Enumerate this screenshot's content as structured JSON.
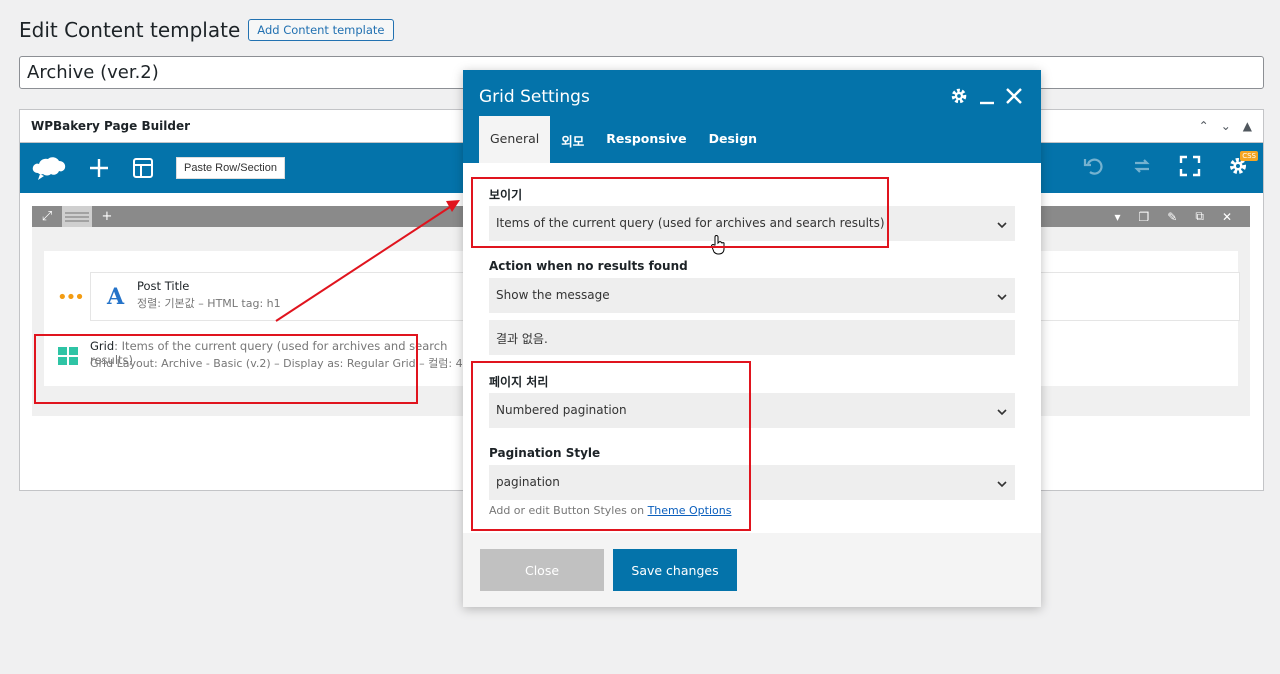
{
  "page": {
    "title": "Edit Content template",
    "add_button": "Add Content template",
    "title_value": "Archive (ver.2)"
  },
  "wpbakery": {
    "title": "WPBakery Page Builder",
    "paste_button": "Paste Row/Section",
    "css_badge": "CSS",
    "elements": [
      {
        "title": "Post Title",
        "subtitle": "정렬: 기본값  – HTML tag: h1"
      },
      {
        "title_strong": "Grid",
        "title_rest": ": Items of the current query (used for archives and search results)",
        "subtitle": "Grid Layout: Archive - Basic (v.2) – Display as: Regular Grid – 컬럼: 4"
      }
    ]
  },
  "modal": {
    "title": "Grid Settings",
    "tabs": [
      "General",
      "외모",
      "Responsive",
      "Design"
    ],
    "fields": {
      "visibility_label": "보이기",
      "visibility_value": "Items of the current query (used for archives and search results)",
      "no_results_label": "Action when no results found",
      "no_results_value": "Show the message",
      "message_value": "결과 없음.",
      "pagination_label": "페이지 처리",
      "pagination_value": "Numbered pagination",
      "pagination_style_label": "Pagination Style",
      "pagination_style_value": "pagination",
      "help_text": "Add or edit Button Styles on ",
      "help_link": "Theme Options"
    },
    "close_button": "Close",
    "save_button": "Save changes"
  },
  "colors": {
    "accent": "#0473aa",
    "annotation": "#e0141e"
  }
}
